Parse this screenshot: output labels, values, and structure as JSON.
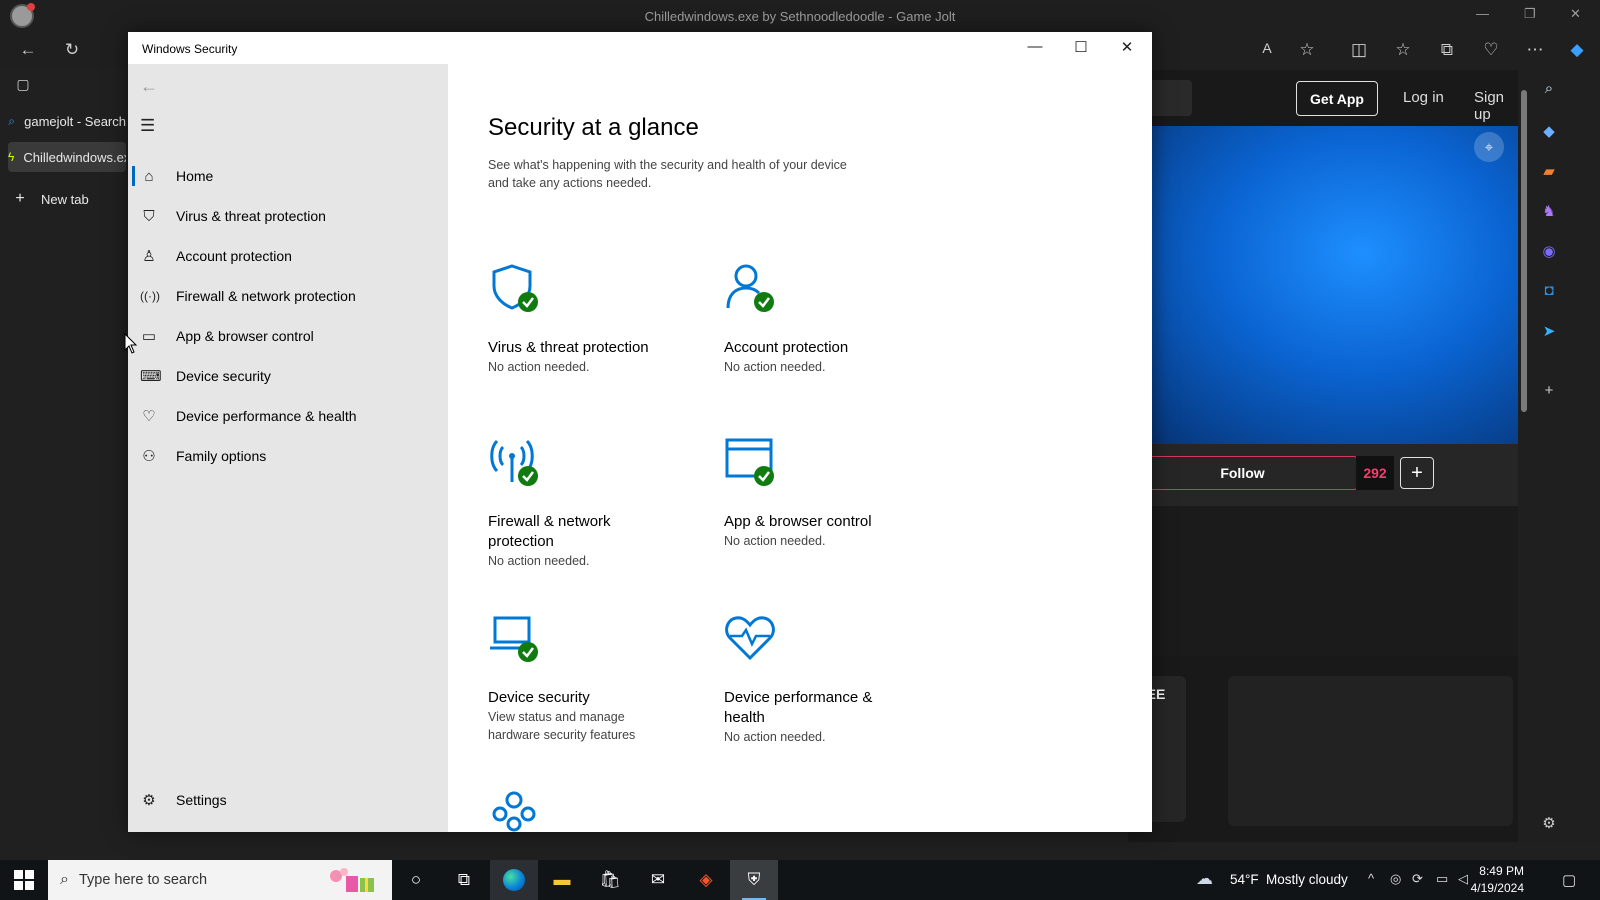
{
  "browser": {
    "title": "Chilledwindows.exe by Sethnoodledoodle - Game Jolt",
    "tabs": [
      {
        "label": "gamejolt - Search"
      },
      {
        "label": "Chilledwindows.exe by Sethnoodledoodle - Game Jolt"
      },
      {
        "label": "New tab"
      }
    ]
  },
  "gamejolt": {
    "get_app": "Get App",
    "log_in": "Log in",
    "sign_up": "Sign up",
    "follow": "Follow",
    "follow_count": "292",
    "plus": "+",
    "free_badge": "FREE"
  },
  "window": {
    "title": "Windows Security"
  },
  "nav": {
    "items": [
      {
        "label": "Home",
        "icon": "home-icon"
      },
      {
        "label": "Virus & threat protection",
        "icon": "shield-icon"
      },
      {
        "label": "Account protection",
        "icon": "person-icon"
      },
      {
        "label": "Firewall & network protection",
        "icon": "antenna-icon"
      },
      {
        "label": "App & browser control",
        "icon": "browser-window-icon"
      },
      {
        "label": "Device security",
        "icon": "laptop-icon"
      },
      {
        "label": "Device performance & health",
        "icon": "heart-icon"
      },
      {
        "label": "Family options",
        "icon": "family-icon"
      }
    ],
    "settings": "Settings"
  },
  "main": {
    "heading": "Security at a glance",
    "description": "See what's happening with the security and health of your device and take any actions needed.",
    "tiles": [
      {
        "name": "Virus & threat protection",
        "status": "No action needed."
      },
      {
        "name": "Account protection",
        "status": "No action needed."
      },
      {
        "name": "Firewall & network protection",
        "status": "No action needed."
      },
      {
        "name": "App & browser control",
        "status": "No action needed."
      },
      {
        "name": "Device security",
        "status": "View status and manage hardware security features"
      },
      {
        "name": "Device performance & health",
        "status": "No action needed."
      }
    ]
  },
  "taskbar": {
    "search_placeholder": "Type here to search",
    "weather_temp": "54°F",
    "weather_desc": "Mostly cloudy",
    "time": "8:49 PM",
    "date": "4/19/2024"
  },
  "colors": {
    "accent": "#0067c0",
    "ok_green": "#107c10",
    "icon_blue": "#0078d4",
    "follow_count_red": "#ff3a6e"
  }
}
